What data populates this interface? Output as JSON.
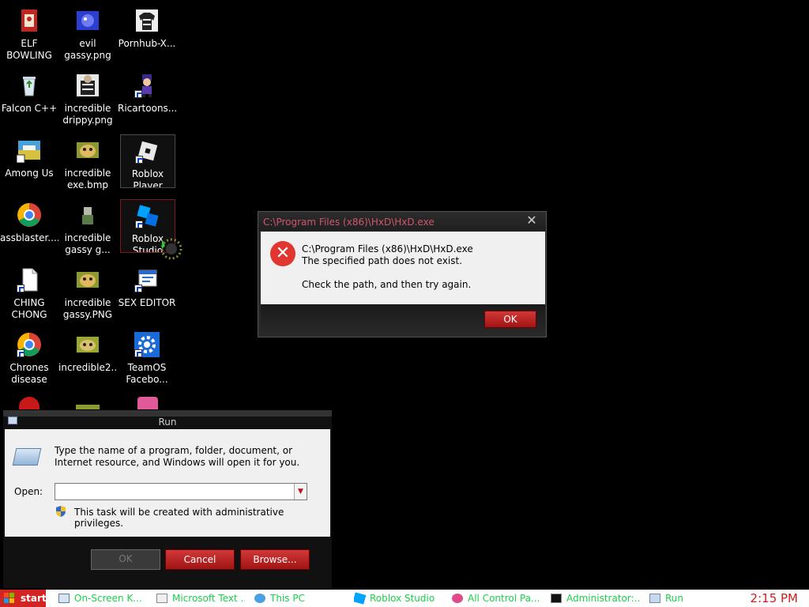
{
  "desktop": {
    "icons": [
      {
        "label": "ELF BOWLING",
        "icon": "elf-bowling-icon"
      },
      {
        "label": "evil gassy.png",
        "icon": "image-file-icon"
      },
      {
        "label": "Pornhub-X...",
        "icon": "sweater-image-icon"
      },
      {
        "label": "Falcon C++",
        "icon": "recycle-bin-icon"
      },
      {
        "label": "incredible drippy.png",
        "icon": "image-file-icon"
      },
      {
        "label": "Ricartoons...",
        "icon": "character-icon"
      },
      {
        "label": "Among Us",
        "icon": "game-icon"
      },
      {
        "label": "incredible exe.bmp",
        "icon": "image-file-icon"
      },
      {
        "label": "Roblox Player",
        "icon": "roblox-player-icon"
      },
      {
        "label": "assblaster....",
        "icon": "chrome-icon"
      },
      {
        "label": "incredible gassy g...",
        "icon": "image-file-icon"
      },
      {
        "label": "Roblox Studio",
        "icon": "roblox-studio-icon"
      },
      {
        "label": "CHING CHONG",
        "icon": "document-icon"
      },
      {
        "label": "incredible gassy.PNG",
        "icon": "image-file-icon"
      },
      {
        "label": "SEX EDITOR",
        "icon": "editor-icon"
      },
      {
        "label": "Chrones disease",
        "icon": "chrome-icon"
      },
      {
        "label": "incredible2....",
        "icon": "image-file-icon"
      },
      {
        "label": "TeamOS Facebo...",
        "icon": "gear-icon"
      }
    ]
  },
  "error_dialog": {
    "title": "C:\\Program Files (x86)\\HxD\\HxD.exe",
    "close_glyph": "✕",
    "path": "C:\\Program Files (x86)\\HxD\\HxD.exe",
    "message": "The specified path does not exist.",
    "hint": "Check the path, and then try again.",
    "ok_label": "OK"
  },
  "run_dialog": {
    "title": "Run",
    "description": "Type the name of a program, folder, document, or Internet resource, and Windows will open it for you.",
    "open_label": "Open:",
    "open_value": "",
    "admin_note": "This task will be created with administrative privileges.",
    "ok_label": "OK",
    "cancel_label": "Cancel",
    "browse_label": "Browse..."
  },
  "taskbar": {
    "start_label": "start",
    "items": [
      {
        "label": "On-Screen K...",
        "icon": "keyboard-icon"
      },
      {
        "label": "Microsoft Text ...",
        "icon": "text-input-icon"
      },
      {
        "label": "This PC",
        "icon": "computer-icon"
      },
      {
        "label": "Roblox Studio",
        "icon": "roblox-studio-icon"
      },
      {
        "label": "All Control Pa...",
        "icon": "control-panel-icon"
      },
      {
        "label": "Administrator:...",
        "icon": "cmd-icon"
      },
      {
        "label": "Run",
        "icon": "run-icon"
      }
    ],
    "clock": "2:15 PM"
  },
  "colors": {
    "accent_red": "#d32424",
    "taskbar_text": "#1bd04a",
    "clock": "#d01c1c"
  }
}
